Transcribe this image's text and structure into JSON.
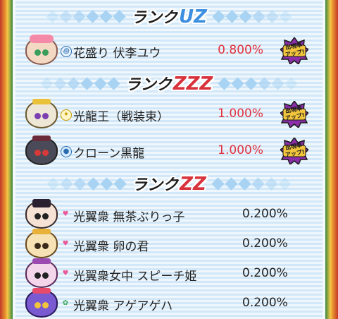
{
  "colors": {
    "rate_up": "#e0323f",
    "rate_normal": "#222222",
    "panel_bg": "#dceefa",
    "rank_uz": "#3d8fe0",
    "rank_zzz": "#d8323c",
    "rank_zz": "#d8323c"
  },
  "badge": {
    "line1": "出現率",
    "line2": "アップ!",
    "icon": "starburst-badge-icon"
  },
  "sections": [
    {
      "rank_word": "ランク",
      "rank_code": "UZ",
      "rows": [
        {
          "name": "花盛り 伏李ユウ",
          "rate": "0.800%",
          "boosted": true,
          "tribe_icon": "swirl-icon"
        }
      ]
    },
    {
      "rank_word": "ランク",
      "rank_code": "ZZZ",
      "rows": [
        {
          "name": "光龍王（戦装束）",
          "rate": "1.000%",
          "boosted": true,
          "tribe_icon": "bulb-icon"
        },
        {
          "name": "クローン黒龍",
          "rate": "1.000%",
          "boosted": true,
          "tribe_icon": "slime-icon"
        }
      ]
    },
    {
      "rank_word": "ランク",
      "rank_code": "ZZ",
      "rows": [
        {
          "name": "光翼衆 無茶ぶりっ子",
          "rate": "0.200%",
          "boosted": false,
          "tribe_icon": "heart-icon"
        },
        {
          "name": "光翼衆 卵の君",
          "rate": "0.200%",
          "boosted": false,
          "tribe_icon": "heart-icon"
        },
        {
          "name": "光翼衆女中 スピーチ姫",
          "rate": "0.200%",
          "boosted": false,
          "tribe_icon": "heart-icon"
        },
        {
          "name": "光翼衆 アゲアゲハ",
          "rate": "0.200%",
          "boosted": false,
          "tribe_icon": "flower-icon"
        }
      ]
    }
  ]
}
